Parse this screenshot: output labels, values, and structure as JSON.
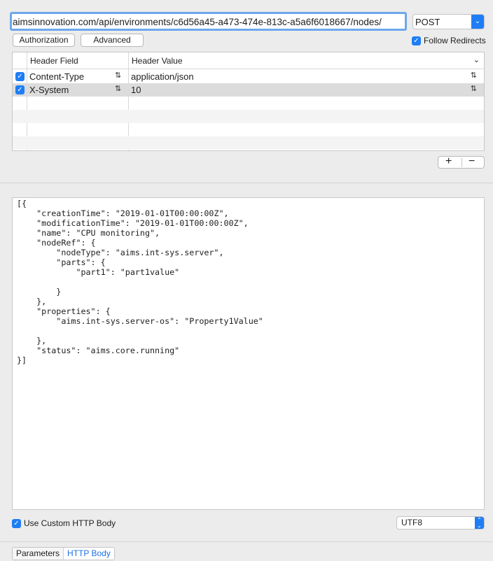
{
  "request": {
    "url": "aimsinnovation.com/api/environments/c6d56a45-a473-474e-813c-a5a6f6018667/nodes/",
    "method": "POST"
  },
  "buttons": {
    "authorization": "Authorization",
    "advanced": "Advanced"
  },
  "follow_redirects": {
    "label": "Follow Redirects",
    "checked": true
  },
  "headers_table": {
    "col_field": "Header Field",
    "col_value": "Header Value",
    "rows": [
      {
        "enabled": true,
        "field": "Content-Type",
        "value": "application/json"
      },
      {
        "enabled": true,
        "field": "X-System",
        "value": "10"
      }
    ]
  },
  "body": {
    "text": "[{\n    \"creationTime\": \"2019-01-01T00:00:00Z\",\n    \"modificationTime\": \"2019-01-01T00:00:00Z\",\n    \"name\": \"CPU monitoring\",\n    \"nodeRef\": {\n        \"nodeType\": \"aims.int-sys.server\",\n        \"parts\": {\n            \"part1\": \"part1value\"\n\n        }\n    },\n    \"properties\": {\n        \"aims.int-sys.server-os\": \"Property1Value\"\n\n    },\n    \"status\": \"aims.core.running\"\n}]",
    "use_custom_label": "Use Custom HTTP Body",
    "use_custom_checked": true,
    "encoding": "UTF8"
  },
  "tabs": {
    "parameters": "Parameters",
    "http_body": "HTTP Body",
    "active": "http_body"
  }
}
